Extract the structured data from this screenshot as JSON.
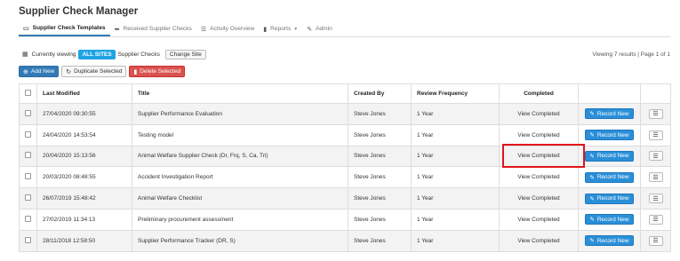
{
  "app": {
    "title": "Supplier Check Manager"
  },
  "nav": [
    {
      "label": "Supplier Check Templates",
      "icon": "inbox-icon",
      "glyph": "▭"
    },
    {
      "label": "Received Supplier Checks",
      "icon": "arrow-left-icon",
      "glyph": "⬅"
    },
    {
      "label": "Activity Overview",
      "icon": "list-icon",
      "glyph": "☰"
    },
    {
      "label": "Reports",
      "icon": "file-icon",
      "glyph": "▮"
    },
    {
      "label": "Admin",
      "icon": "wrench-icon",
      "glyph": "✎"
    }
  ],
  "site": {
    "prefix": "Currently viewing",
    "badge": "ALL SITES",
    "suffix": "Supplier Checks",
    "change_label": "Change Site",
    "viewing": "Viewing 7 results | Page 1 of 1"
  },
  "actions": {
    "add": "Add New",
    "duplicate": "Duplicate Selected",
    "delete": "Delete Selected"
  },
  "table": {
    "headers": {
      "last_modified": "Last Modified",
      "title": "Title",
      "created_by": "Created By",
      "review_frequency": "Review Frequency",
      "completed": "Completed"
    },
    "rows": [
      {
        "modified": "27/04/2020 09:30:55",
        "title": "Supplier Performance Evaluation",
        "created_by": "Steve Jones",
        "frequency": "1 Year",
        "completed": "View Completed",
        "record": "Record New"
      },
      {
        "modified": "24/04/2020 14:53:54",
        "title": "Testing model",
        "created_by": "Steve Jones",
        "frequency": "1 Year",
        "completed": "View Completed",
        "record": "Record New"
      },
      {
        "modified": "20/04/2020 15:13:56",
        "title": "Animal Welfare Supplier Check (Dr, Frq, S, Ca, Tri)",
        "created_by": "Steve Jones",
        "frequency": "1 Year",
        "completed": "View Completed",
        "record": "Record New"
      },
      {
        "modified": "20/03/2020 08:48:55",
        "title": "Accident Investigation Report",
        "created_by": "Steve Jones",
        "frequency": "1 Year",
        "completed": "View Completed",
        "record": "Record New"
      },
      {
        "modified": "26/07/2019 15:48:42",
        "title": "Animal Welfare Checklist",
        "created_by": "Steve Jones",
        "frequency": "1 Year",
        "completed": "View Completed",
        "record": "Record New"
      },
      {
        "modified": "27/02/2019 11:34:13",
        "title": "Preliminary procurement assessment",
        "created_by": "Steve Jones",
        "frequency": "1 Year",
        "completed": "View Completed",
        "record": "Record New"
      },
      {
        "modified": "28/11/2018 12:58:50",
        "title": "Supplier Performance Tracker (DR, S)",
        "created_by": "Steve Jones",
        "frequency": "1 Year",
        "completed": "View Completed",
        "record": "Record New"
      }
    ]
  },
  "colors": {
    "highlight": "#e0151b",
    "primary": "#337ab7",
    "badge": "#1fa3e4",
    "danger": "#d9534f"
  }
}
